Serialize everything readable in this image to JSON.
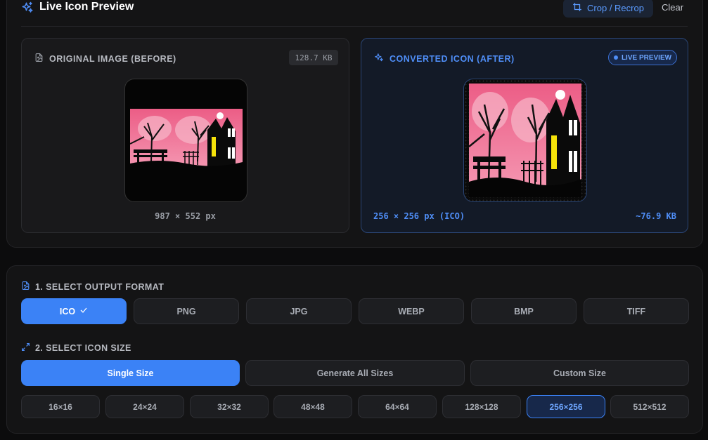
{
  "header": {
    "title": "Live Icon Preview",
    "crop_label": "Crop / Recrop",
    "clear_label": "Clear"
  },
  "before": {
    "title": "ORIGINAL IMAGE (BEFORE)",
    "size_badge": "128.7 KB",
    "dimensions": "987 × 552 px"
  },
  "after": {
    "title": "CONVERTED ICON (AFTER)",
    "live_badge": "LIVE PREVIEW",
    "dimensions": "256 × 256 px (ICO)",
    "size": "~76.9 KB"
  },
  "format": {
    "label": "1. SELECT OUTPUT FORMAT",
    "options": [
      "ICO",
      "PNG",
      "JPG",
      "WEBP",
      "BMP",
      "TIFF"
    ],
    "selected": "ICO"
  },
  "icon_size": {
    "label": "2. SELECT ICON SIZE",
    "modes": [
      "Single Size",
      "Generate All Sizes",
      "Custom Size"
    ],
    "selected_mode": "Single Size",
    "sizes": [
      "16×16",
      "24×24",
      "32×32",
      "48×48",
      "64×64",
      "128×128",
      "256×256",
      "512×512"
    ],
    "selected_size": "256×256"
  },
  "colors": {
    "accent": "#3b82f6",
    "accent_text": "#4f8ef7",
    "background": "#0c0c0d",
    "panel": "#141415"
  }
}
